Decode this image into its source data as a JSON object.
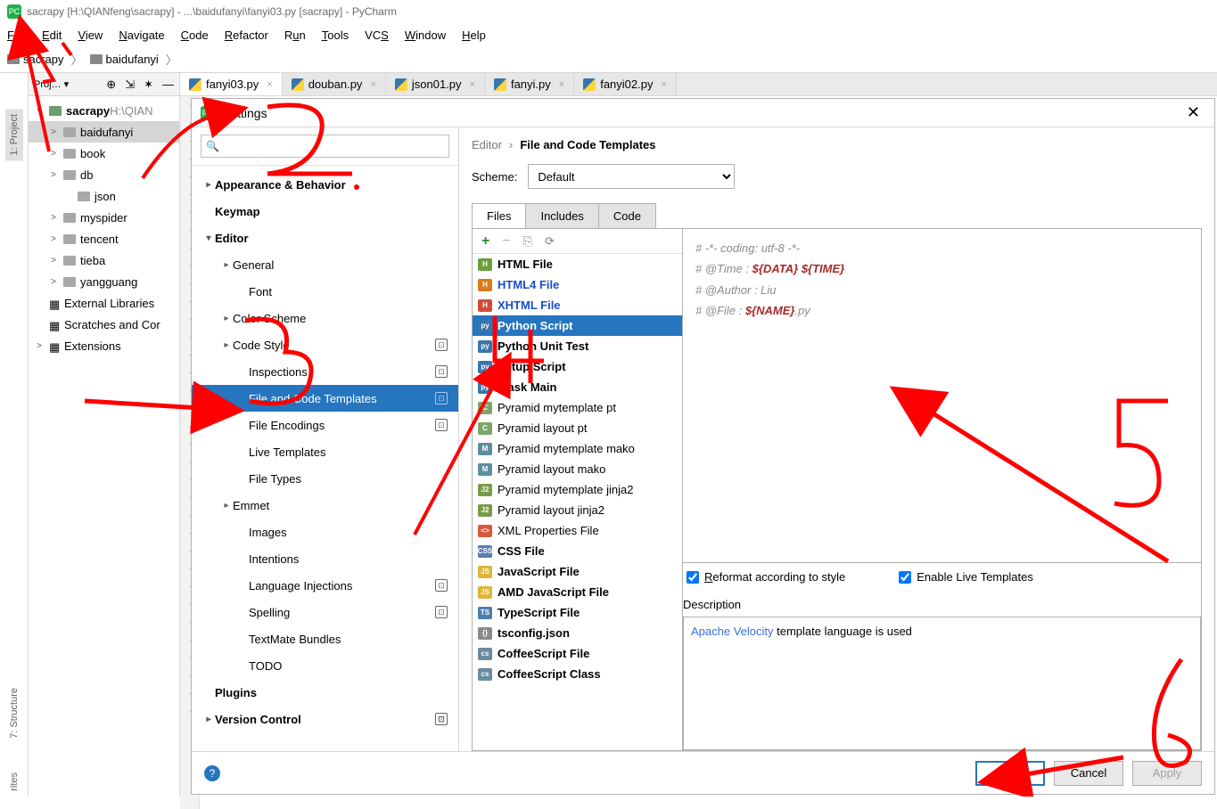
{
  "window": {
    "title": "sacrapy [H:\\QIANfeng\\sacrapy] - ...\\baidufanyi\\fanyi03.py [sacrapy] - PyCharm"
  },
  "menu": [
    "File",
    "Edit",
    "View",
    "Navigate",
    "Code",
    "Refactor",
    "Run",
    "Tools",
    "VCS",
    "Window",
    "Help"
  ],
  "breadcrumb": [
    {
      "label": "sacrapy"
    },
    {
      "label": "baidufanyi"
    }
  ],
  "side_tabs": {
    "project": "1: Project",
    "structure": "7: Structure",
    "favorites": "rites"
  },
  "project_tree": {
    "root": {
      "label": "sacrapy",
      "hint": " H:\\QIAN"
    },
    "items": [
      {
        "label": "baidufanyi",
        "selected": true,
        "indent": 1,
        "arrow": ">"
      },
      {
        "label": "book",
        "indent": 1,
        "arrow": ">"
      },
      {
        "label": "db",
        "indent": 1,
        "arrow": ">"
      },
      {
        "label": "json",
        "indent": 2,
        "arrow": ""
      },
      {
        "label": "myspider",
        "indent": 1,
        "arrow": ">"
      },
      {
        "label": "tencent",
        "indent": 1,
        "arrow": ">"
      },
      {
        "label": "tieba",
        "indent": 1,
        "arrow": ">"
      },
      {
        "label": "yangguang",
        "indent": 1,
        "arrow": ">"
      }
    ],
    "extras": [
      {
        "label": "External Libraries"
      },
      {
        "label": "Scratches and Cor"
      },
      {
        "label": "Extensions",
        "arrow": ">"
      }
    ]
  },
  "editor_tabs": [
    {
      "label": "fanyi03.py",
      "active": true
    },
    {
      "label": "douban.py"
    },
    {
      "label": "json01.py"
    },
    {
      "label": "fanyi.py"
    },
    {
      "label": "fanyi02.py"
    }
  ],
  "dialog": {
    "title": "Settings",
    "search_placeholder": "",
    "nav": [
      {
        "label": "Appearance & Behavior",
        "type": "group",
        "arrow": ">"
      },
      {
        "label": "Keymap",
        "type": "group"
      },
      {
        "label": "Editor",
        "type": "group",
        "arrow": "v"
      },
      {
        "label": "General",
        "indent": 1,
        "arrow": ">"
      },
      {
        "label": "Font",
        "indent": 2
      },
      {
        "label": "Color Scheme",
        "indent": 1,
        "arrow": ">"
      },
      {
        "label": "Code Style",
        "indent": 1,
        "arrow": ">",
        "badge": true
      },
      {
        "label": "Inspections",
        "indent": 2,
        "badge": true
      },
      {
        "label": "File and Code Templates",
        "indent": 2,
        "selected": true,
        "badge": true
      },
      {
        "label": "File Encodings",
        "indent": 2,
        "badge": true
      },
      {
        "label": "Live Templates",
        "indent": 2
      },
      {
        "label": "File Types",
        "indent": 2
      },
      {
        "label": "Emmet",
        "indent": 1,
        "arrow": ">"
      },
      {
        "label": "Images",
        "indent": 2
      },
      {
        "label": "Intentions",
        "indent": 2
      },
      {
        "label": "Language Injections",
        "indent": 2,
        "badge": true
      },
      {
        "label": "Spelling",
        "indent": 2,
        "badge": true
      },
      {
        "label": "TextMate Bundles",
        "indent": 2
      },
      {
        "label": "TODO",
        "indent": 2
      },
      {
        "label": "Plugins",
        "type": "group"
      },
      {
        "label": "Version Control",
        "type": "group",
        "arrow": ">",
        "badge": true
      }
    ],
    "right": {
      "crumb_parent": "Editor",
      "crumb_sep": "›",
      "crumb_current": "File and Code Templates",
      "scheme_label": "Scheme:",
      "scheme_value": "Default",
      "tabs": [
        "Files",
        "Includes",
        "Code"
      ],
      "active_tab": "Files",
      "templates": [
        {
          "label": "HTML File",
          "icon": "H",
          "color": "#6b9e3e",
          "bold": true
        },
        {
          "label": "HTML4 File",
          "icon": "H",
          "color": "#d97d1a",
          "blue": true
        },
        {
          "label": "XHTML File",
          "icon": "H",
          "color": "#d14b3a",
          "blue": true
        },
        {
          "label": "Python Script",
          "icon": "py",
          "color": "#3776ab",
          "bold": true,
          "selected": true
        },
        {
          "label": "Python Unit Test",
          "icon": "py",
          "color": "#3776ab",
          "bold": true
        },
        {
          "label": "Setup Script",
          "icon": "py",
          "color": "#3776ab",
          "bold": true
        },
        {
          "label": "Flask Main",
          "icon": "py",
          "color": "#3776ab",
          "bold": true
        },
        {
          "label": "Pyramid mytemplate pt",
          "icon": "C",
          "color": "#7aa767"
        },
        {
          "label": "Pyramid layout pt",
          "icon": "C",
          "color": "#7aa767"
        },
        {
          "label": "Pyramid mytemplate mako",
          "icon": "M",
          "color": "#5d8f9e"
        },
        {
          "label": "Pyramid layout mako",
          "icon": "M",
          "color": "#5d8f9e"
        },
        {
          "label": "Pyramid mytemplate jinja2",
          "icon": "J2",
          "color": "#7a9a4a"
        },
        {
          "label": "Pyramid layout jinja2",
          "icon": "J2",
          "color": "#7a9a4a"
        },
        {
          "label": "XML Properties File",
          "icon": "<>",
          "color": "#d65a3a"
        },
        {
          "label": "CSS File",
          "icon": "CSS",
          "color": "#5a7cb0",
          "bold": true
        },
        {
          "label": "JavaScript File",
          "icon": "JS",
          "color": "#e0b33a",
          "bold": true
        },
        {
          "label": "AMD JavaScript File",
          "icon": "JS",
          "color": "#e0b33a",
          "bold": true
        },
        {
          "label": "TypeScript File",
          "icon": "TS",
          "color": "#4a7fb0",
          "bold": true
        },
        {
          "label": "tsconfig.json",
          "icon": "{}",
          "color": "#8a8a8a",
          "bold": true
        },
        {
          "label": "CoffeeScript File",
          "icon": "cs",
          "color": "#6a8aa0",
          "bold": true
        },
        {
          "label": "CoffeeScript Class",
          "icon": "cs",
          "color": "#6a8aa0",
          "bold": true
        }
      ],
      "code_lines": [
        {
          "pre": "# -*- coding: utf-8 -*-"
        },
        {
          "pre": "# @Time    : ",
          "vars": [
            "${DATA}",
            " ",
            "${TIME}"
          ]
        },
        {
          "pre": "# @Author  : Liu"
        },
        {
          "pre": "# @File    : ",
          "vars": [
            "${NAME}"
          ],
          "post": ".py"
        }
      ],
      "reformat_label": "Reformat according to style",
      "live_label": "Enable Live Templates",
      "desc_label": "Description",
      "desc_link": "Apache Velocity",
      "desc_text": " template language is used"
    },
    "buttons": {
      "ok": "OK",
      "cancel": "Cancel",
      "apply": "Apply"
    }
  }
}
